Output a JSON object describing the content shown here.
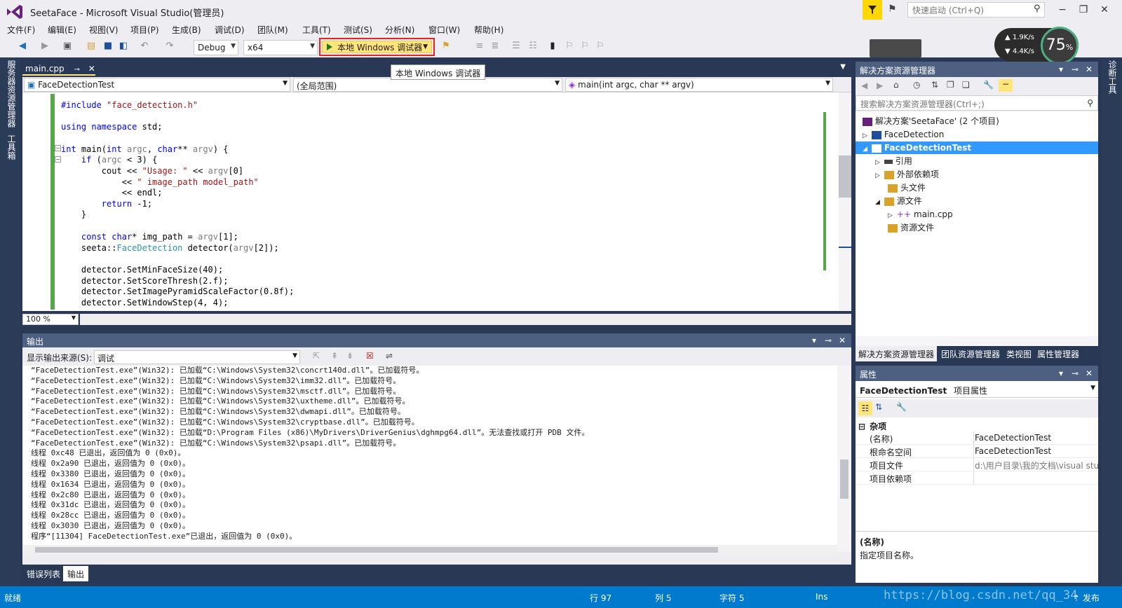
{
  "window": {
    "title": "SeetaFace - Microsoft Visual Studio(管理员)",
    "quick_launch_placeholder": "快速启动 (Ctrl+Q)"
  },
  "menu": [
    "文件(F)",
    "编辑(E)",
    "视图(V)",
    "项目(P)",
    "生成(B)",
    "调试(D)",
    "团队(M)",
    "工具(T)",
    "测试(S)",
    "分析(N)",
    "窗口(W)",
    "帮助(H)"
  ],
  "toolbar": {
    "config": "Debug",
    "platform": "x64",
    "run_label": "本地 Windows 调试器",
    "tooltip": "本地 Windows 调试器"
  },
  "netmonitor": {
    "up": "1.9K/s",
    "down": "4.4K/s",
    "percent": "75",
    "percent_suffix": "%"
  },
  "left_rail": {
    "server_explorer": "服务器资源管理器",
    "toolbox": "工具箱"
  },
  "right_rail": {
    "diagnostics": "诊断工具"
  },
  "editor": {
    "tab": "main.cpp",
    "nav_scope": "FaceDetectionTest",
    "nav_global": "(全局范围)",
    "nav_func": "main(int argc, char ** argv)",
    "zoom": "100 %"
  },
  "output": {
    "title": "输出",
    "source_label": "显示输出来源(S):",
    "source_value": "调试",
    "lines": [
      "“FaceDetectionTest.exe”(Win32): 已加载“C:\\Windows\\System32\\concrt140d.dll”。已加载符号。",
      "“FaceDetectionTest.exe”(Win32): 已加载“C:\\Windows\\System32\\imm32.dll”。已加载符号。",
      "“FaceDetectionTest.exe”(Win32): 已加载“C:\\Windows\\System32\\msctf.dll”。已加载符号。",
      "“FaceDetectionTest.exe”(Win32): 已加载“C:\\Windows\\System32\\uxtheme.dll”。已加载符号。",
      "“FaceDetectionTest.exe”(Win32): 已加载“C:\\Windows\\System32\\dwmapi.dll”。已加载符号。",
      "“FaceDetectionTest.exe”(Win32): 已加载“C:\\Windows\\System32\\cryptbase.dll”。已加载符号。",
      "“FaceDetectionTest.exe”(Win32): 已加载“D:\\Program Files (x86)\\MyDrivers\\DriverGenius\\dghmpg64.dll”。无法查找或打开 PDB 文件。",
      "“FaceDetectionTest.exe”(Win32): 已加载“C:\\Windows\\System32\\psapi.dll”。已加载符号。",
      "线程 0xc48 已退出，返回值为 0 (0x0)。",
      "线程 0x2a90 已退出，返回值为 0 (0x0)。",
      "线程 0x3380 已退出，返回值为 0 (0x0)。",
      "线程 0x1634 已退出，返回值为 0 (0x0)。",
      "线程 0x2c80 已退出，返回值为 0 (0x0)。",
      "线程 0x31dc 已退出，返回值为 0 (0x0)。",
      "线程 0x28cc 已退出，返回值为 0 (0x0)。",
      "线程 0x3030 已退出，返回值为 0 (0x0)。",
      "程序“[11304] FaceDetectionTest.exe”已退出，返回值为 0 (0x0)。"
    ]
  },
  "bottom_tabs": {
    "errors": "错误列表",
    "output": "输出"
  },
  "solution": {
    "title": "解决方案资源管理器",
    "search_placeholder": "搜索解决方案资源管理器(Ctrl+;)",
    "tree": {
      "root": "解决方案'SeetaFace' (2 个项目)",
      "p1": "FaceDetection",
      "p2": "FaceDetectionTest",
      "refs": "引用",
      "extdeps": "外部依赖项",
      "headers": "头文件",
      "sources": "源文件",
      "maincpp": "main.cpp",
      "resources": "资源文件"
    },
    "tabs": [
      "解决方案资源管理器",
      "团队资源管理器",
      "类视图",
      "属性管理器"
    ]
  },
  "properties": {
    "title": "属性",
    "object": "FaceDetectionTest",
    "object_type": "项目属性",
    "category": "杂项",
    "rows": [
      {
        "k": "(名称)",
        "v": "FaceDetectionTest"
      },
      {
        "k": "根命名空间",
        "v": "FaceDetectionTest"
      },
      {
        "k": "项目文件",
        "v": "d:\\用户目录\\我的文档\\visual stu"
      },
      {
        "k": "项目依赖项",
        "v": ""
      }
    ],
    "desc_title": "(名称)",
    "desc_text": "指定项目名称。"
  },
  "status": {
    "ready": "就绪",
    "row": "行 97",
    "col": "列 5",
    "char": "字符 5",
    "ins": "Ins",
    "publish": "发布"
  },
  "watermark": "https://blog.csdn.net/qq_34"
}
